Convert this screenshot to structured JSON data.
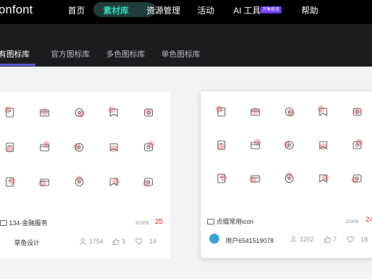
{
  "header": {
    "logo": "onfont",
    "nav": [
      "首页",
      "素材库",
      "资源管理",
      "活动",
      "AI 工具",
      "帮助"
    ],
    "ai_badge": "万象能道"
  },
  "subnav": {
    "tabs": [
      "有图标库",
      "官方图标库",
      "多色图标库",
      "单色图标库"
    ]
  },
  "cards": [
    {
      "title": "134-金融服务",
      "icons_label": "icons",
      "icons_count": "25",
      "author": "草鱼设计",
      "downloads": "1754",
      "likes": "3",
      "favorites": "14"
    },
    {
      "title": "点缀常用icon",
      "icons_label": "icons",
      "icons_count": "24",
      "author": "用户6541519078",
      "downloads": "1252",
      "likes": "7",
      "favorites": "18"
    }
  ],
  "colors": {
    "accent": "#2fd7b8",
    "tab_underline": "#5b5bd6",
    "count": "#e1251b",
    "icon_fill": "#f8c0c4"
  }
}
